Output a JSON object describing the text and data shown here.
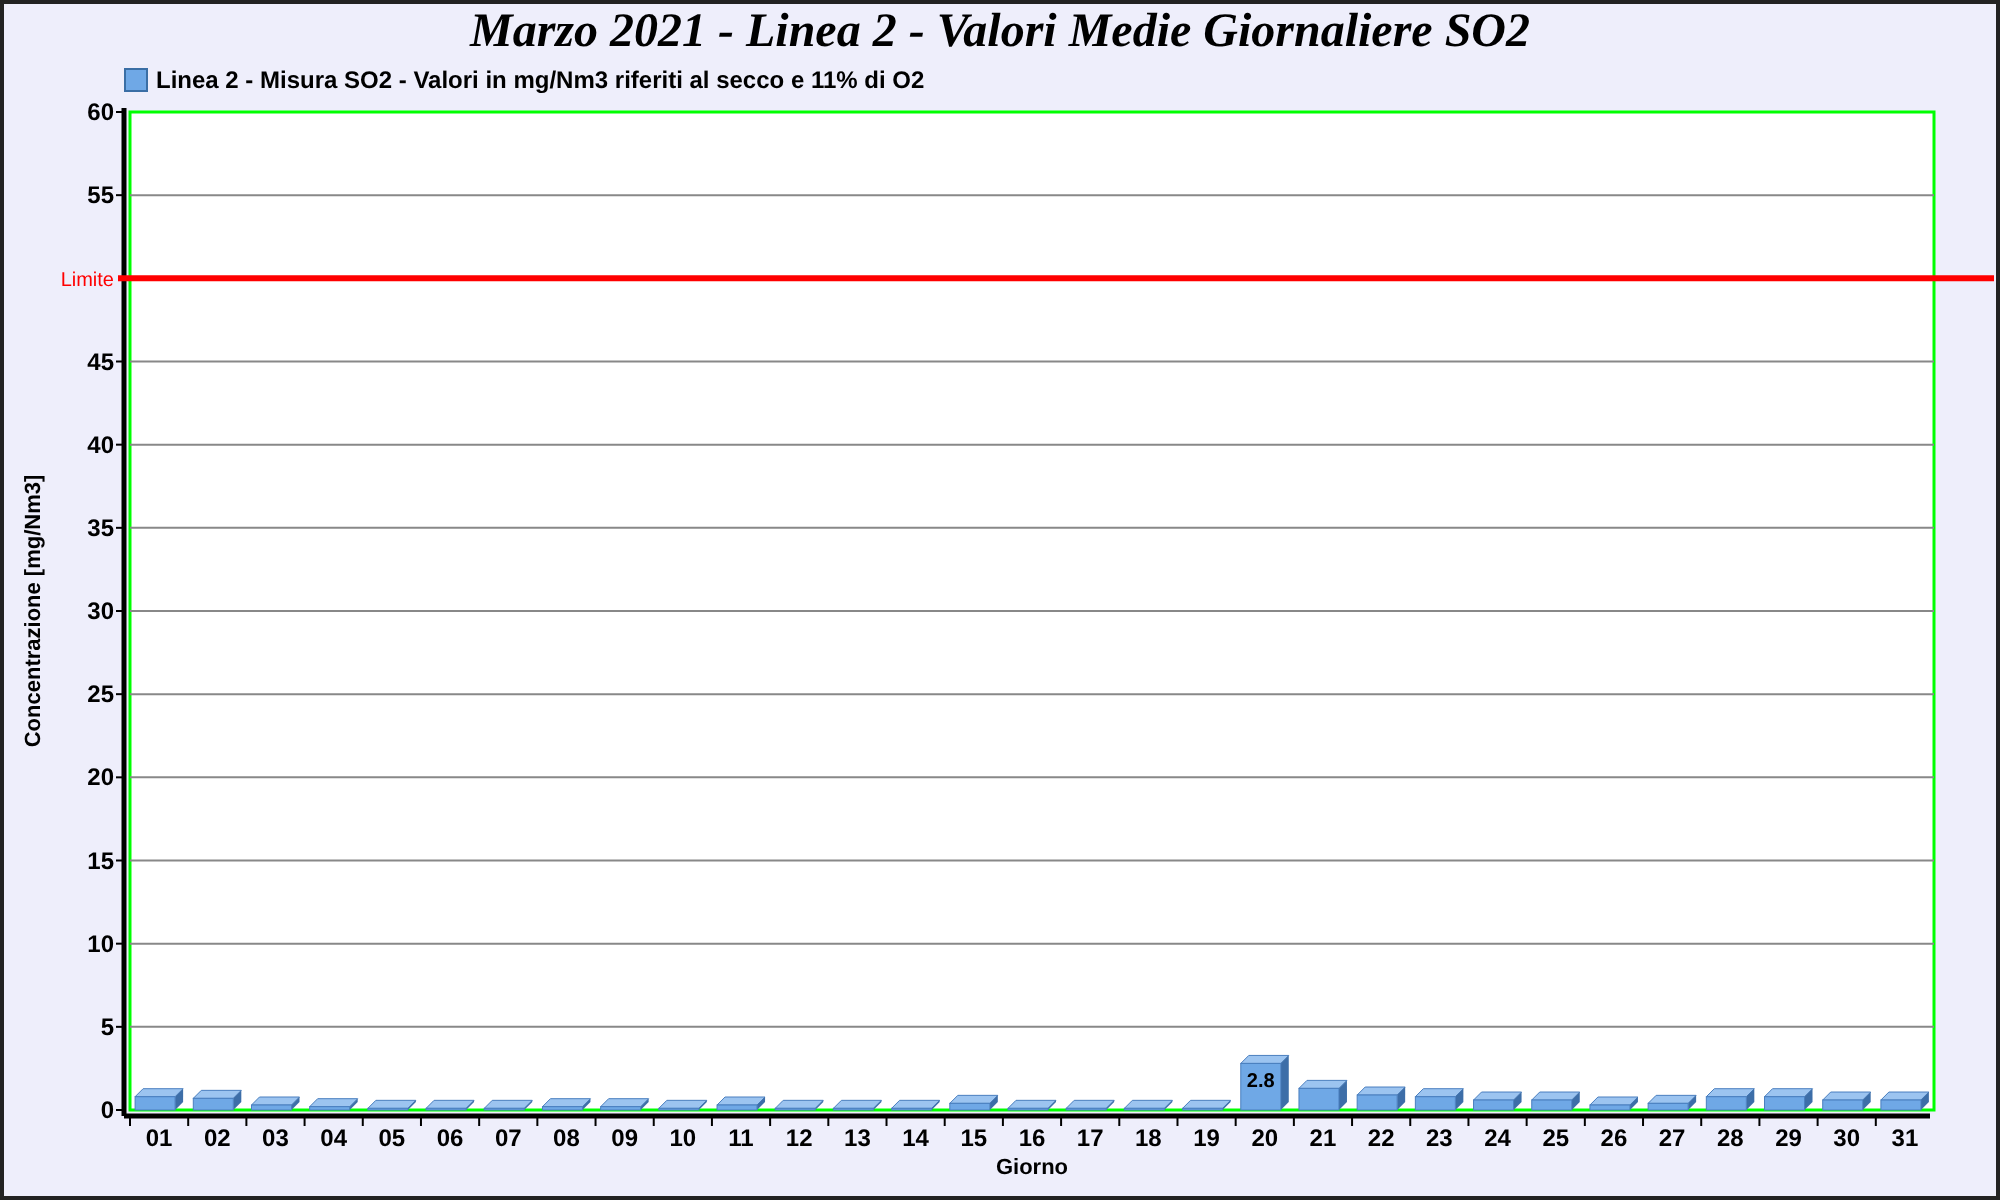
{
  "chart": {
    "title": "Marzo 2021 - Linea 2 - Valori Medie Giornaliere SO2",
    "chart_data": {
      "type": "bar",
      "xlabel": "Giorno",
      "ylabel": "Concentrazione [mg/Nm3]",
      "grid": true,
      "categories": [
        "01",
        "02",
        "03",
        "04",
        "05",
        "06",
        "07",
        "08",
        "09",
        "10",
        "11",
        "12",
        "13",
        "14",
        "15",
        "16",
        "17",
        "18",
        "19",
        "20",
        "21",
        "22",
        "23",
        "24",
        "25",
        "26",
        "27",
        "28",
        "29",
        "30",
        "31"
      ],
      "series": [
        {
          "name": "Linea 2 - Misura SO2 - Valori in mg/Nm3 riferiti al secco e 11% di O2",
          "color": "#6fa8e6",
          "values": [
            0.8,
            0.7,
            0.3,
            0.2,
            0.1,
            0.1,
            0.1,
            0.2,
            0.2,
            0.1,
            0.3,
            0.1,
            0.1,
            0.1,
            0.4,
            0.1,
            0.1,
            0.1,
            0.1,
            2.8,
            1.3,
            0.9,
            0.8,
            0.6,
            0.6,
            0.3,
            0.4,
            0.8,
            0.8,
            0.6,
            0.6
          ]
        }
      ],
      "ylim": [
        0,
        60
      ],
      "yticks": [
        0,
        5,
        10,
        15,
        20,
        25,
        30,
        35,
        40,
        45,
        55,
        60
      ],
      "ref_lines": [
        {
          "axis": "y",
          "value": 50,
          "label": "Limite",
          "color": "#ff0000"
        }
      ],
      "annotations": [
        {
          "x": "20",
          "y": 2.8,
          "text": "2.8"
        }
      ]
    }
  }
}
